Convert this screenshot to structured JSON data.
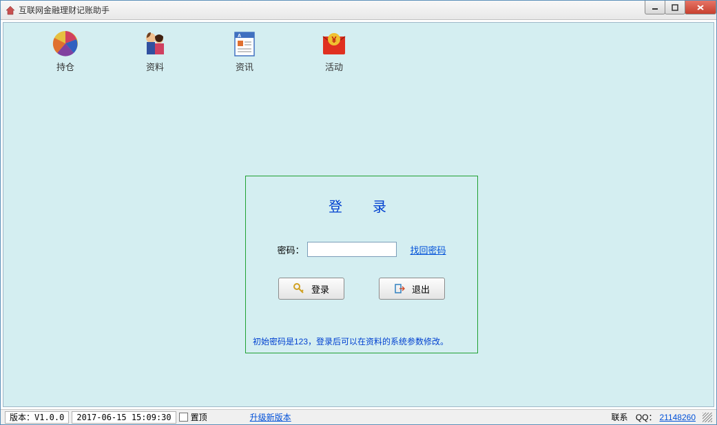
{
  "window": {
    "title": "互联网金融理财记账助手"
  },
  "toolbar": {
    "items": [
      {
        "label": "持仓"
      },
      {
        "label": "资料"
      },
      {
        "label": "资讯"
      },
      {
        "label": "活动"
      }
    ]
  },
  "login": {
    "title": "登　录",
    "password_label": "密码：",
    "password_value": "",
    "forgot_link": "找回密码",
    "login_button": "登录",
    "exit_button": "退出",
    "hint": "初始密码是123，登录后可以在资料的系统参数修改。"
  },
  "statusbar": {
    "version": "版本：V1.0.0",
    "datetime": "2017-06-15 15:09:30",
    "pin_label": "置顶",
    "upgrade_link": "升级新版本",
    "contact_label": "联系",
    "qq_label": "QQ：",
    "qq_number": "21148260"
  }
}
